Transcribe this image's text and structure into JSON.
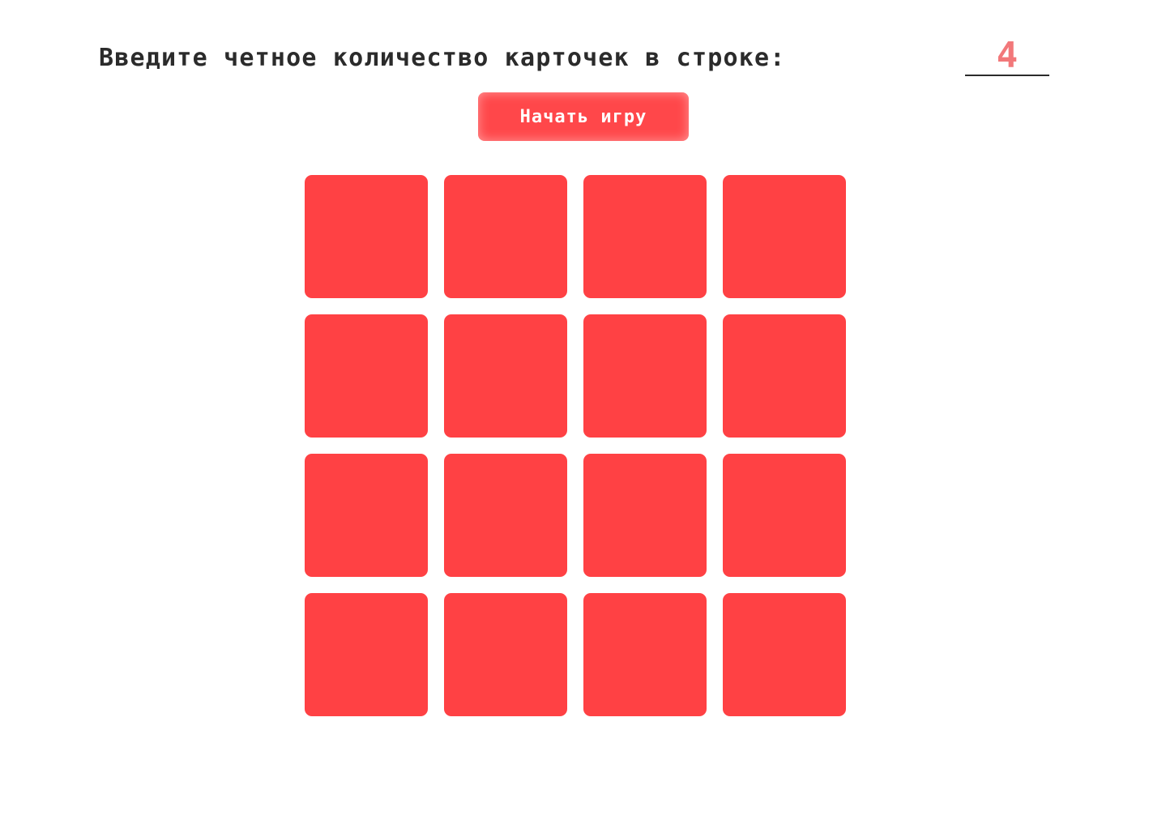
{
  "prompt": {
    "label": "Введите четное количество карточек в строке:",
    "input_value": "4",
    "input_placeholder": ""
  },
  "start_button": {
    "label": "Начать игру"
  },
  "board": {
    "columns": 4,
    "rows": 4,
    "card_color": "#ff4144"
  },
  "colors": {
    "accent": "#ff474a",
    "input_text": "#f2787a",
    "text": "#2b2b2b"
  }
}
